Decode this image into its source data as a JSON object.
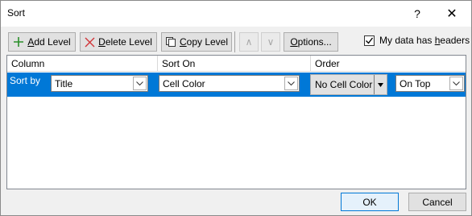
{
  "window": {
    "title": "Sort",
    "help": "?",
    "close": "✕"
  },
  "toolbar": {
    "add_level": {
      "accel": "A",
      "rest": "dd Level"
    },
    "delete_level": {
      "accel": "D",
      "rest": "elete Level"
    },
    "copy_level": {
      "accel": "C",
      "rest": "opy Level"
    },
    "options": {
      "accel": "O",
      "rest": "ptions..."
    },
    "move_up": "∧",
    "move_down": "∨"
  },
  "headers_checkbox": {
    "checked": true,
    "label_pre": "My data has ",
    "accel": "h",
    "label_post": "eaders"
  },
  "grid": {
    "headers": {
      "column": "Column",
      "sort_on": "Sort On",
      "order": "Order"
    },
    "rows": [
      {
        "label": "Sort by",
        "column": "Title",
        "sort_on": "Cell Color",
        "color": "No Cell Color",
        "position": "On Top"
      }
    ]
  },
  "footer": {
    "ok": "OK",
    "cancel": "Cancel"
  },
  "colors": {
    "accent": "#0078d7",
    "add_icon": "#2a8f2a",
    "delete_icon": "#d13438"
  }
}
